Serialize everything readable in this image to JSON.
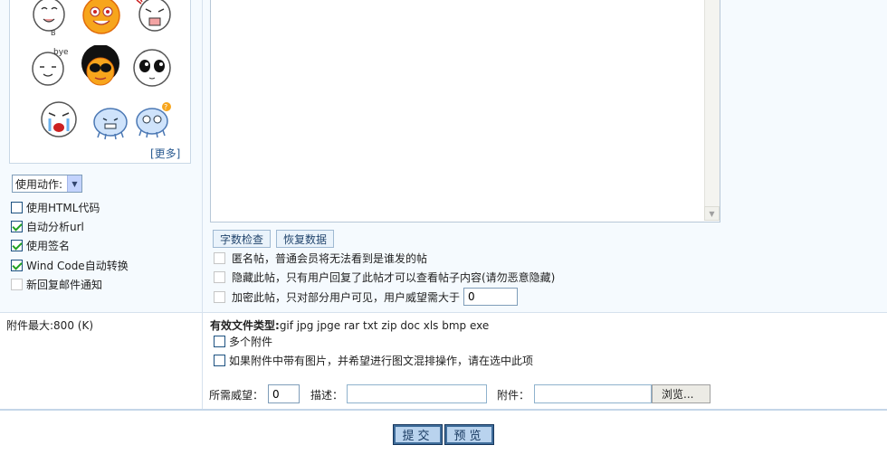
{
  "emoticons": [
    "smile-face-icon",
    "orange-grin-icon",
    "cry-face-icon",
    "bye-face-icon",
    "afro-sunglasses-icon",
    "big-eyes-face-icon",
    "crying-face-icon",
    "blue-blob-icon",
    "confused-blob-icon"
  ],
  "more_link": "[更多]",
  "action_select": {
    "value": "使用动作:"
  },
  "left_options": [
    {
      "label": "使用HTML代码",
      "checked": false
    },
    {
      "label": "自动分析url",
      "checked": true
    },
    {
      "label": "使用签名",
      "checked": true
    },
    {
      "label": "Wind Code自动转换",
      "checked": true
    },
    {
      "label": "新回复邮件通知",
      "checked": false
    }
  ],
  "editor_buttons": {
    "word_check": "字数检查",
    "restore": "恢复数据"
  },
  "post_options": {
    "anonymous": "匿名帖，普通会员将无法看到是谁发的帖",
    "hidden": "隐藏此帖，只有用户回复了此帖才可以查看帖子内容(请勿恶意隐藏)",
    "encrypt": "加密此帖，只对部分用户可见，用户威望需大于",
    "encrypt_value": "0"
  },
  "attachment": {
    "max_size": "附件最大:800 (K)",
    "types_label": "有效文件类型:",
    "types_value": "gif jpg jpge rar txt zip doc xls bmp exe",
    "multi": "多个附件",
    "mixed": "如果附件中带有图片，并希望进行图文混排操作，请在选中此项",
    "rep_label": "所需威望：",
    "rep_value": "0",
    "desc_label": "描述：",
    "file_label": "附件：",
    "browse": "浏览..."
  },
  "submit": {
    "submit": "提交",
    "preview": "预览"
  }
}
